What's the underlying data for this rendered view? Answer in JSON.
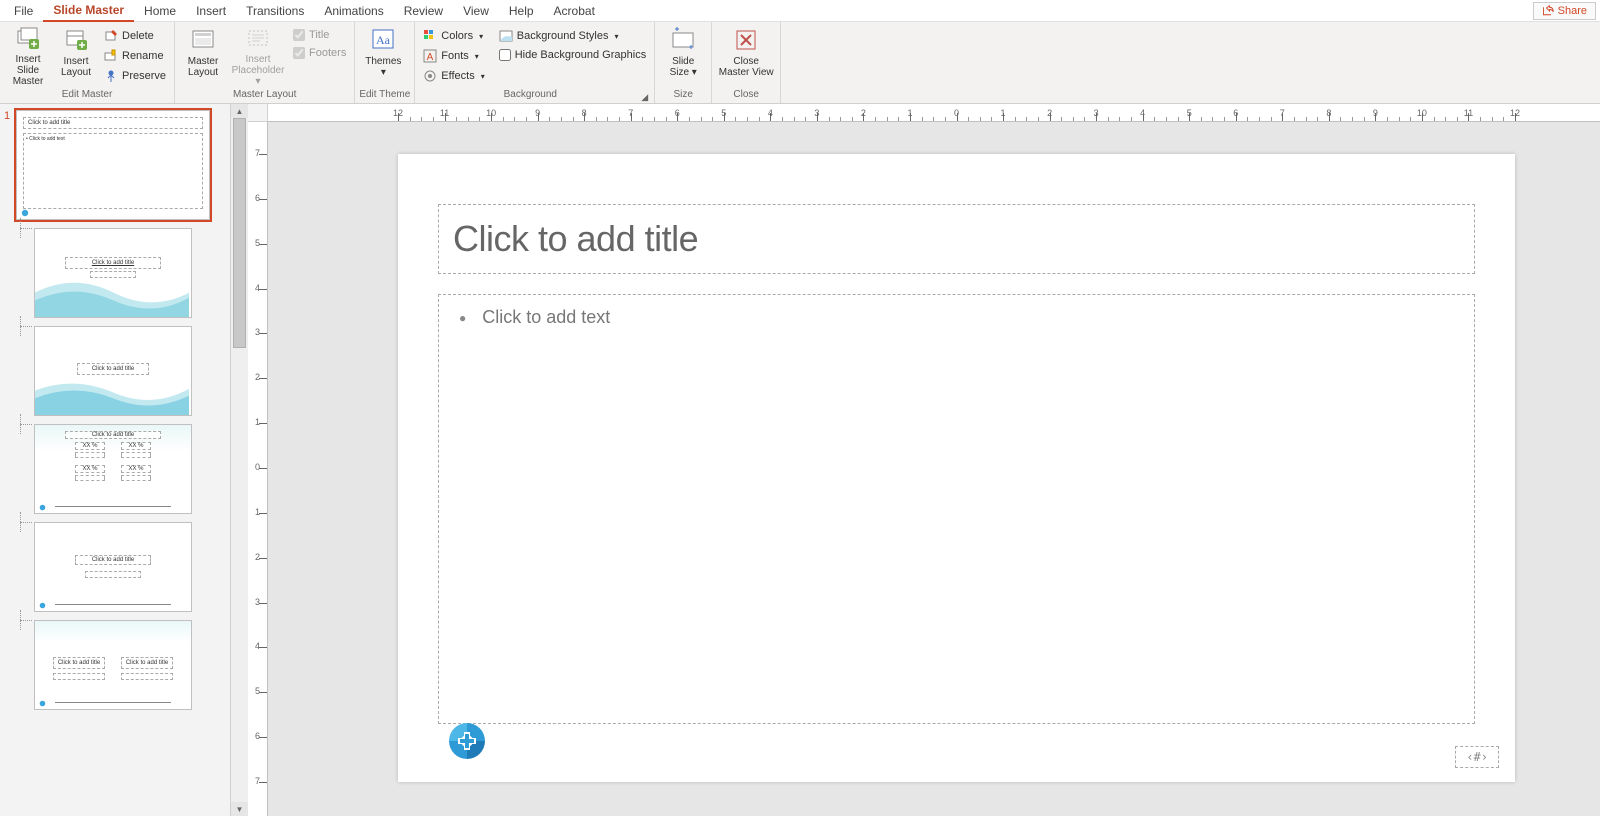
{
  "menu": {
    "items": [
      "File",
      "Slide Master",
      "Home",
      "Insert",
      "Transitions",
      "Animations",
      "Review",
      "View",
      "Help",
      "Acrobat"
    ],
    "active_index": 1,
    "share_label": "Share"
  },
  "ribbon": {
    "groups": {
      "edit_master": {
        "label": "Edit Master",
        "insert_slide_master": "Insert Slide\nMaster",
        "insert_layout": "Insert\nLayout",
        "delete": "Delete",
        "rename": "Rename",
        "preserve": "Preserve"
      },
      "master_layout": {
        "label": "Master Layout",
        "master_layout_btn": "Master\nLayout",
        "insert_placeholder": "Insert\nPlaceholder",
        "title_chk": "Title",
        "footers_chk": "Footers"
      },
      "edit_theme": {
        "label": "Edit Theme",
        "themes": "Themes"
      },
      "background": {
        "label": "Background",
        "colors": "Colors",
        "fonts": "Fonts",
        "effects": "Effects",
        "bg_styles": "Background Styles",
        "hide_bg": "Hide Background Graphics"
      },
      "size": {
        "label": "Size",
        "slide_size": "Slide\nSize"
      },
      "close": {
        "label": "Close",
        "close_master": "Close\nMaster View"
      }
    }
  },
  "thumbs": {
    "master_number": "1",
    "layout_titles": {
      "master_title": "Click to add title",
      "master_body": "• Click to add text",
      "t1": "Click to add title",
      "t2": "Click to add title",
      "t3": "Click to add title",
      "t4": "Click to add title",
      "t5a": "Click to add title",
      "t5b": "Click to add title"
    },
    "xx_percent": "XX %"
  },
  "ruler": {
    "h": [
      "12",
      "11",
      "10",
      "9",
      "8",
      "7",
      "6",
      "5",
      "4",
      "3",
      "2",
      "1",
      "0",
      "1",
      "2",
      "3",
      "4",
      "5",
      "6",
      "7",
      "8",
      "9",
      "10",
      "11",
      "12"
    ],
    "v": [
      "7",
      "6",
      "5",
      "4",
      "3",
      "2",
      "1",
      "0",
      "1",
      "2",
      "3",
      "4",
      "5",
      "6",
      "7"
    ]
  },
  "slide": {
    "title_placeholder": "Click to add title",
    "body_placeholder": "Click to add text",
    "slide_number_placeholder": "‹#›"
  }
}
